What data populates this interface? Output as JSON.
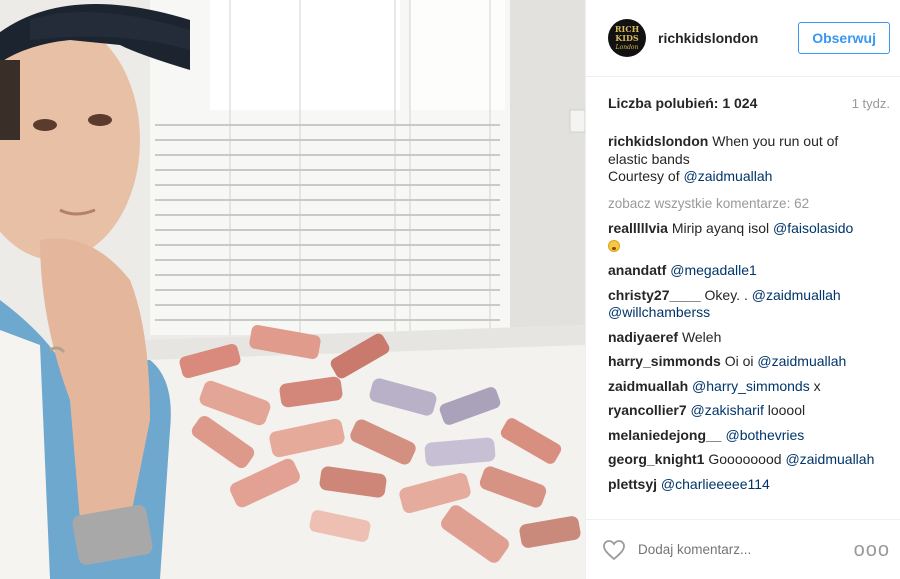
{
  "post": {
    "username": "richkidslondon",
    "avatar_text": {
      "line1": "RICH",
      "line2": "KIDS",
      "line3": "London"
    },
    "follow_label": "Obserwuj",
    "likes_label": "Liczba polubień: 1 024",
    "time_label": "1 tydz.",
    "caption": {
      "user": "richkidslondon",
      "text": "When you run out of elastic bands",
      "line2": "Courtesy of",
      "mention": "@zaidmuallah"
    },
    "view_all_label": "zobacz wszystkie komentarze: 62",
    "comments": [
      {
        "user": "realllllvia",
        "text": "Mirip ayanq isol",
        "mention": "@faisolasido",
        "emoji": "anguished-face"
      },
      {
        "user": "anandatf",
        "text": "",
        "mention": "@megadalle1"
      },
      {
        "user": "christy27____",
        "text": "Okey.  .",
        "mention": "@zaidmuallah @willchamberss"
      },
      {
        "user": "nadiyaeref",
        "text": "Weleh",
        "mention": ""
      },
      {
        "user": "harry_simmonds",
        "text": "Oi oi",
        "mention": "@zaidmuallah"
      },
      {
        "user": "zaidmuallah",
        "text": "",
        "mention": "@harry_simmonds",
        "after": "x"
      },
      {
        "user": "ryancollier7",
        "text": "",
        "mention": "@zakisharif",
        "after": "looool"
      },
      {
        "user": "melaniedejong__",
        "text": "",
        "mention": "@bothevries"
      },
      {
        "user": "georg_knight1",
        "text": "Goooooood",
        "mention": "@zaidmuallah"
      },
      {
        "user": "plettsyj",
        "text": "",
        "mention": "@charlieeeee114"
      }
    ],
    "add_comment_placeholder": "Dodaj komentarz...",
    "more_label": "ooo",
    "icons": {
      "like": "heart-outline-icon",
      "more": "more-options-icon"
    },
    "colors": {
      "accent": "#3897f0",
      "mention": "#003569",
      "muted": "#999999"
    }
  }
}
